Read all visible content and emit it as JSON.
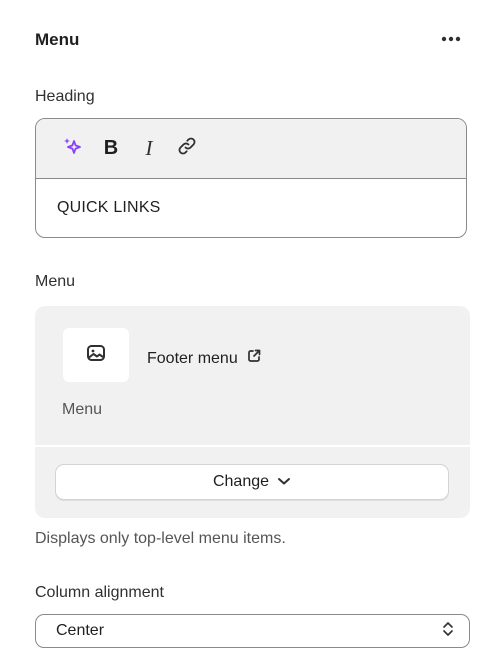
{
  "panel": {
    "title": "Menu",
    "more_icon": "ellipsis-horizontal-icon"
  },
  "heading_field": {
    "label": "Heading",
    "toolbar": {
      "ai_icon": "sparkle-icon",
      "bold_label": "B",
      "italic_label": "I",
      "link_icon": "link-icon"
    },
    "value": "QUICK LINKS"
  },
  "menu_field": {
    "label": "Menu",
    "selected": {
      "icon": "image-icon",
      "name": "Footer menu",
      "external_icon": "external-link-icon",
      "subtitle": "Menu"
    },
    "change_label": "Change",
    "change_icon": "chevron-down-icon",
    "help_text": "Displays only top-level menu items."
  },
  "column_alignment": {
    "label": "Column alignment",
    "selected": "Center",
    "icon": "select-updown-icon"
  },
  "colors": {
    "accent_ai": "#8a3ffc",
    "text": "#303030",
    "border": "#8a8a8a",
    "card_bg": "#f1f1f1"
  }
}
